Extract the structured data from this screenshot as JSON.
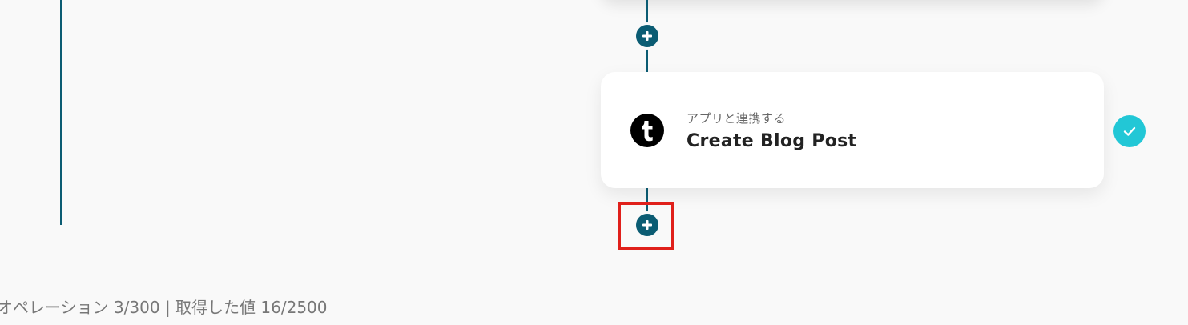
{
  "flow": {
    "steps": [
      {
        "app_icon": "tumblr-icon",
        "category": "アプリと連携する",
        "title": "Create Blog Post",
        "status": "completed",
        "status_icon": "check-icon"
      }
    ],
    "add_step_icon": "plus-icon"
  },
  "status_bar": {
    "text": "オペレーション 3/300 | 取得した値 16/2500"
  },
  "colors": {
    "flow_line": "#0b5c73",
    "check_badge": "#22c7d6",
    "highlight_border": "#e0201b",
    "background": "#f9f9f9"
  }
}
